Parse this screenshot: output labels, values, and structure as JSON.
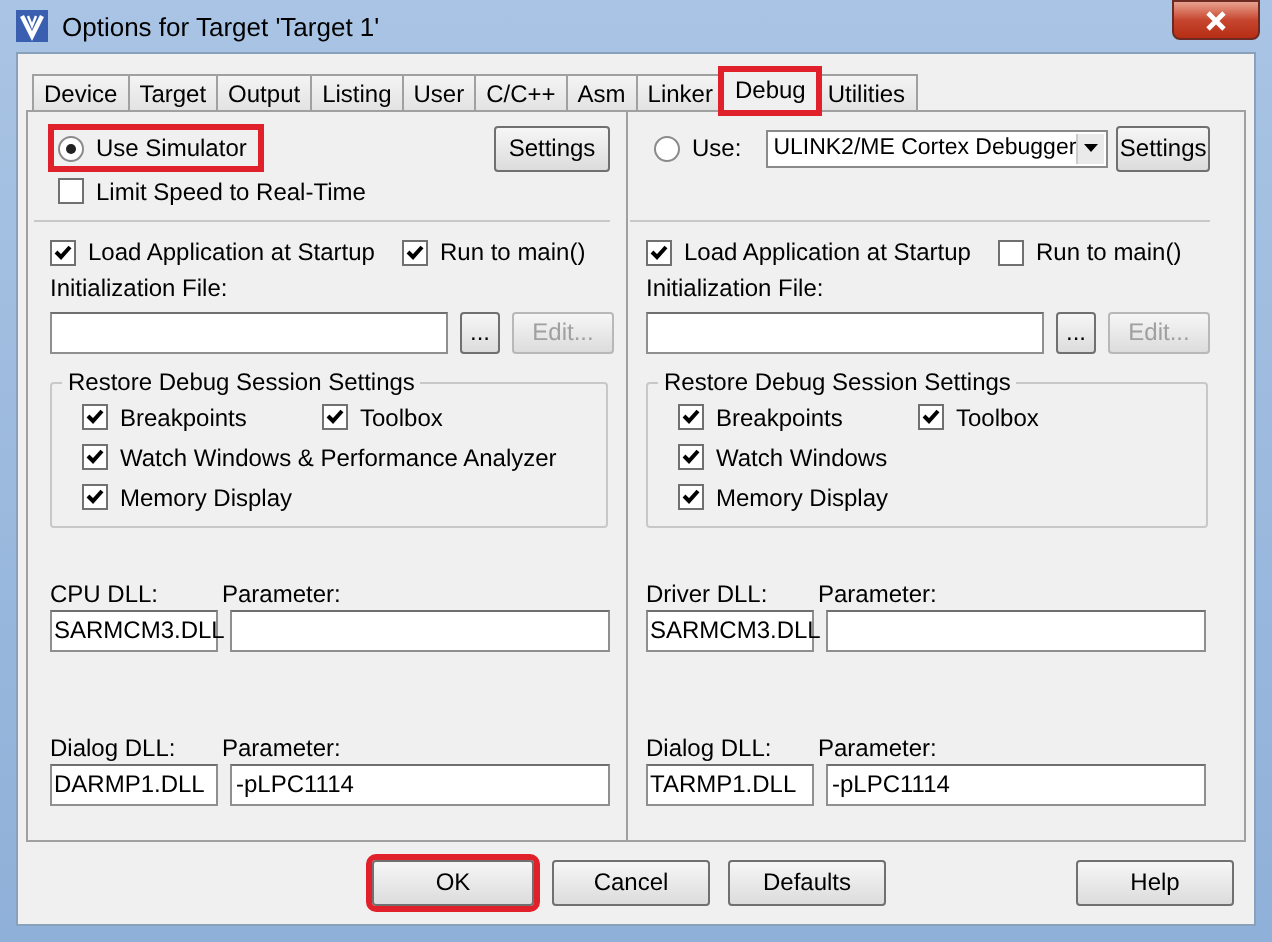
{
  "window": {
    "title": "Options for Target 'Target 1'"
  },
  "tabs": [
    {
      "label": "Device",
      "selected": false,
      "highlighted": false
    },
    {
      "label": "Target",
      "selected": false,
      "highlighted": false
    },
    {
      "label": "Output",
      "selected": false,
      "highlighted": false
    },
    {
      "label": "Listing",
      "selected": false,
      "highlighted": false
    },
    {
      "label": "User",
      "selected": false,
      "highlighted": false
    },
    {
      "label": "C/C++",
      "selected": false,
      "highlighted": false
    },
    {
      "label": "Asm",
      "selected": false,
      "highlighted": false
    },
    {
      "label": "Linker",
      "selected": false,
      "highlighted": false
    },
    {
      "label": "Debug",
      "selected": true,
      "highlighted": true
    },
    {
      "label": "Utilities",
      "selected": false,
      "highlighted": false
    }
  ],
  "sides": [
    {
      "mode": {
        "label": "Use Simulator",
        "selected": true,
        "highlighted": true
      },
      "settings_button": "Settings",
      "limit_speed": {
        "label": "Limit Speed to Real-Time",
        "checked": false
      },
      "load_app": {
        "label": "Load Application at Startup",
        "checked": true
      },
      "run_to_main": {
        "label": "Run to main()",
        "checked": true
      },
      "init_file": {
        "label": "Initialization File:",
        "browse_button": "...",
        "edit_button": {
          "label": "Edit...",
          "disabled": true
        }
      },
      "restore": {
        "title": "Restore Debug Session Settings",
        "options": [
          {
            "label": "Breakpoints",
            "checked": true
          },
          {
            "label": "Toolbox",
            "checked": true
          },
          {
            "label": "Watch Windows & Performance Analyzer",
            "checked": true
          },
          {
            "label": "Memory Display",
            "checked": true
          }
        ]
      },
      "dlls": [
        {
          "label": "CPU DLL:",
          "value": "SARMCM3.DLL",
          "param_label": "Parameter:"
        },
        {
          "label": "Dialog DLL:",
          "value": "DARMP1.DLL",
          "param_label": "Parameter:",
          "param_value": "-pLPC1114"
        }
      ]
    },
    {
      "mode": {
        "label": "Use:",
        "selected": false,
        "highlighted": false
      },
      "debugger": "ULINK2/ME Cortex Debugger",
      "settings_button": "Settings",
      "load_app": {
        "label": "Load Application at Startup",
        "checked": true
      },
      "run_to_main": {
        "label": "Run to main()",
        "checked": false
      },
      "init_file": {
        "label": "Initialization File:",
        "browse_button": "...",
        "edit_button": {
          "label": "Edit...",
          "disabled": true
        }
      },
      "restore": {
        "title": "Restore Debug Session Settings",
        "options": [
          {
            "label": "Breakpoints",
            "checked": true
          },
          {
            "label": "Toolbox",
            "checked": true
          },
          {
            "label": "Watch Windows",
            "checked": true
          },
          {
            "label": "Memory Display",
            "checked": true
          }
        ]
      },
      "dlls": [
        {
          "label": "Driver DLL:",
          "value": "SARMCM3.DLL",
          "param_label": "Parameter:"
        },
        {
          "label": "Dialog DLL:",
          "value": "TARMP1.DLL",
          "param_label": "Parameter:",
          "param_value": "-pLPC1114"
        }
      ]
    }
  ],
  "buttons": [
    {
      "label": "OK",
      "highlighted": true
    },
    {
      "label": "Cancel",
      "highlighted": false
    },
    {
      "label": "Defaults",
      "highlighted": false
    },
    {
      "label": "Help",
      "highlighted": false
    }
  ]
}
